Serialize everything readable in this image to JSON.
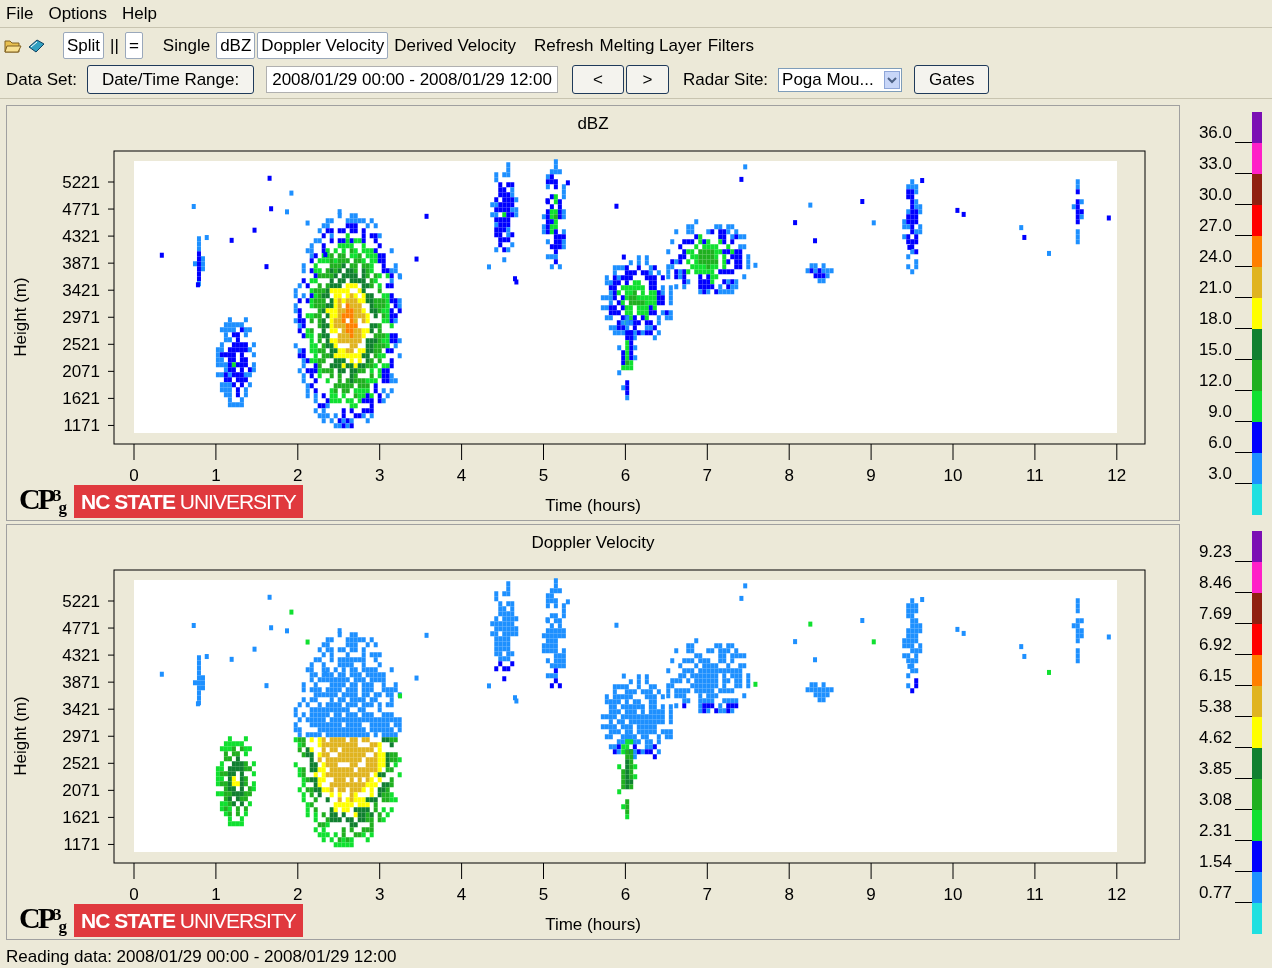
{
  "menu": [
    "File",
    "Options",
    "Help"
  ],
  "toolbar": {
    "toggles": [
      {
        "label": "Split",
        "selected": true
      },
      {
        "label": "||",
        "selected": false
      },
      {
        "label": "=",
        "selected": true
      },
      {
        "label": "Single",
        "selected": false
      },
      {
        "label": "dBZ",
        "selected": true
      },
      {
        "label": "Doppler Velocity",
        "selected": true
      },
      {
        "label": "Derived Velocity",
        "selected": false
      }
    ],
    "actions": [
      "Refresh",
      "Melting Layer",
      "Filters"
    ]
  },
  "dataset": {
    "label": "Data Set:",
    "range_button": "Date/Time Range:",
    "range_value": "2008/01/29 00:00 - 2008/01/29 12:00",
    "prev": "<",
    "next": ">",
    "site_label": "Radar Site:",
    "site_value": "Poga Mou...",
    "gates": "Gates"
  },
  "panels": [
    {
      "kind": "reflectivity",
      "title": "dBZ",
      "ylabel": "Height (m)",
      "yticks": [
        "5221",
        "4771",
        "4321",
        "3871",
        "3421",
        "2971",
        "2521",
        "2071",
        "1621",
        "1171"
      ],
      "xticks": [
        "0",
        "1",
        "2",
        "3",
        "4",
        "5",
        "6",
        "7",
        "8",
        "9",
        "10",
        "11",
        "12"
      ],
      "xlabel": "Time (hours)",
      "logo": {
        "letters": "CP",
        "sup": "3",
        "sub": "g"
      },
      "banner": "**NC STATE** UNIVERSITY",
      "legend": {
        "labels": [
          "36.0",
          "33.0",
          "30.0",
          "27.0",
          "24.0",
          "21.0",
          "18.0",
          "15.0",
          "12.0",
          "9.0",
          "6.0",
          "3.0"
        ],
        "segments": [
          {
            "color": "#7b0fb4"
          },
          {
            "color": "#ff20c8"
          },
          {
            "color": "#902010"
          },
          {
            "color": "#ff0000"
          },
          {
            "color": "#ff8000"
          },
          {
            "color": "#e0b420"
          },
          {
            "color": "#ffff00"
          },
          {
            "color": "#108030"
          },
          {
            "color": "#20b020"
          },
          {
            "color": "#10e030"
          },
          {
            "color": "#0000ff"
          },
          {
            "color": "#1e90ff"
          },
          {
            "color": "#20e0e0"
          }
        ]
      }
    },
    {
      "kind": "velocity",
      "title": "Doppler Velocity",
      "ylabel": "Height (m)",
      "yticks": [
        "5221",
        "4771",
        "4321",
        "3871",
        "3421",
        "2971",
        "2521",
        "2071",
        "1621",
        "1171"
      ],
      "xticks": [
        "0",
        "1",
        "2",
        "3",
        "4",
        "5",
        "6",
        "7",
        "8",
        "9",
        "10",
        "11",
        "12"
      ],
      "xlabel": "Time (hours)",
      "logo": {
        "letters": "CP",
        "sup": "3",
        "sub": "g"
      },
      "banner": "**NC STATE** UNIVERSITY",
      "legend": {
        "labels": [
          "9.23",
          "8.46",
          "7.69",
          "6.92",
          "6.15",
          "5.38",
          "4.62",
          "3.85",
          "3.08",
          "2.31",
          "1.54",
          "0.77"
        ],
        "segments": [
          {
            "color": "#7b0fb4"
          },
          {
            "color": "#ff20c8"
          },
          {
            "color": "#902010"
          },
          {
            "color": "#ff0000"
          },
          {
            "color": "#ff8000"
          },
          {
            "color": "#e0b420"
          },
          {
            "color": "#ffff00"
          },
          {
            "color": "#108030"
          },
          {
            "color": "#20b020"
          },
          {
            "color": "#10e030"
          },
          {
            "color": "#0000ff"
          },
          {
            "color": "#1e90ff"
          },
          {
            "color": "#20e0e0"
          }
        ]
      }
    }
  ],
  "status": "Reading data: 2008/01/29 00:00 - 2008/01/29 12:00"
}
